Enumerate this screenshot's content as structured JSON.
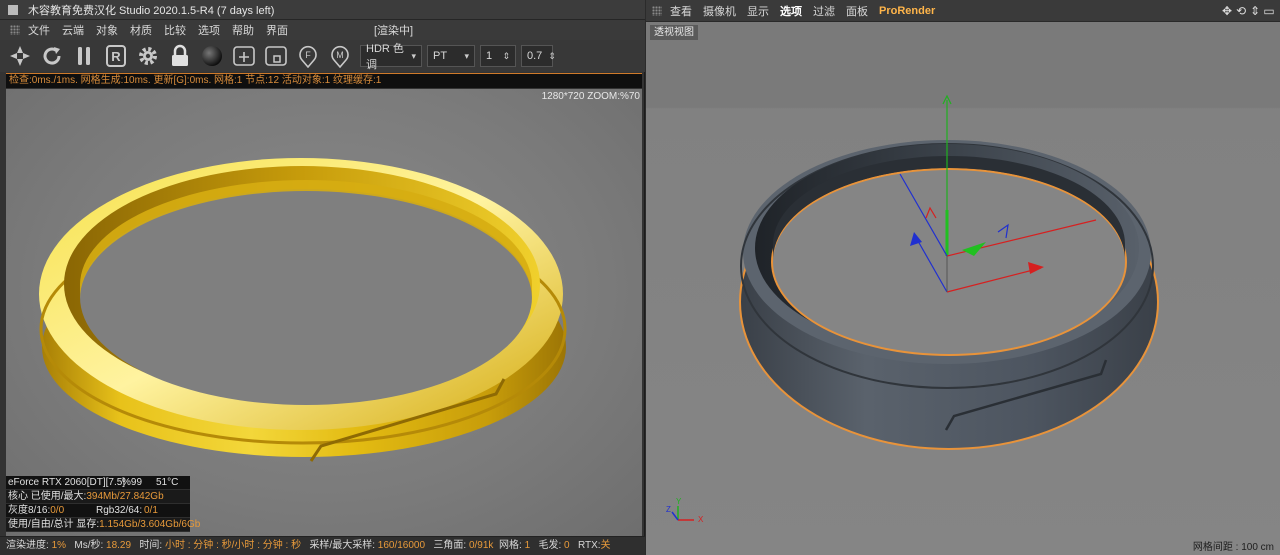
{
  "left": {
    "title": "木容教育免费汉化 Studio 2020.1.5-R4 (7 days left)",
    "menu": [
      "文件",
      "云端",
      "对象",
      "材质",
      "比较",
      "选项",
      "帮助",
      "界面"
    ],
    "render_status": "[渲染中]",
    "toolbar": {
      "icons": [
        "aperture-icon",
        "refresh-icon",
        "pause-icon",
        "region-r-icon",
        "gear-icon",
        "lock-icon",
        "sphere-icon",
        "plus-box-icon",
        "square-box-icon",
        "f-pin-icon",
        "m-pin-icon"
      ],
      "tonemap": "HDR 色调",
      "kernel": "PT",
      "value1": "1",
      "value2": "0.7"
    },
    "info": "检查:0ms./1ms. 网格生成:10ms. 更新[G]:0ms. 网格:1 节点:12 活动对象:1 纹理缓存:1",
    "zoom": "1280*720 ZOOM:%70",
    "gpu": {
      "name": "eForce RTX 2060[DT][7.5]",
      "percent": "%99",
      "temp": "51°C",
      "core_label": "核心 已使用/最大:",
      "core_value": "394Mb/27.842Gb",
      "gray_label": "灰度8/16:",
      "gray_value": "0/0",
      "rgb_label": "Rgb32/64:",
      "rgb_value": "0/1",
      "mem_label": "使用/自由/总计 显存:",
      "mem_value": "1.154Gb/3.604Gb/6Gb"
    },
    "status": {
      "progress_label": "渲染进度:",
      "progress": "1%",
      "ms_label": "Ms/秒:",
      "ms": "18.29",
      "time_label": "时间:",
      "time": "小时 : 分钟 : 秒/小时 : 分钟 : 秒",
      "samples_label": "采样/最大采样:",
      "samples": "160/16000",
      "tri_label": "三角面:",
      "tri": "0/91k",
      "mesh_label": "网格:",
      "mesh": "1",
      "hair_label": "毛发:",
      "hair": "0",
      "rtx_label": "RTX:",
      "rtx": "关"
    }
  },
  "right": {
    "menu": [
      "查看",
      "摄像机",
      "显示",
      "选项",
      "过滤",
      "面板",
      "ProRender"
    ],
    "active_menu": "选项",
    "view_name": "透视视图",
    "grid": "网格间距 : 100 cm",
    "axis": {
      "x": "X",
      "y": "Y",
      "z": "Z"
    },
    "nav_icons": [
      "move-icon",
      "orbit-icon",
      "zoom-icon",
      "maximize-icon"
    ]
  },
  "colors": {
    "gold": "#e8c21a",
    "ring_dark": "#4d5560",
    "accent_orange": "#e89a3a",
    "axis_x": "#d62020",
    "axis_y": "#20b020",
    "axis_z": "#2030d0"
  }
}
